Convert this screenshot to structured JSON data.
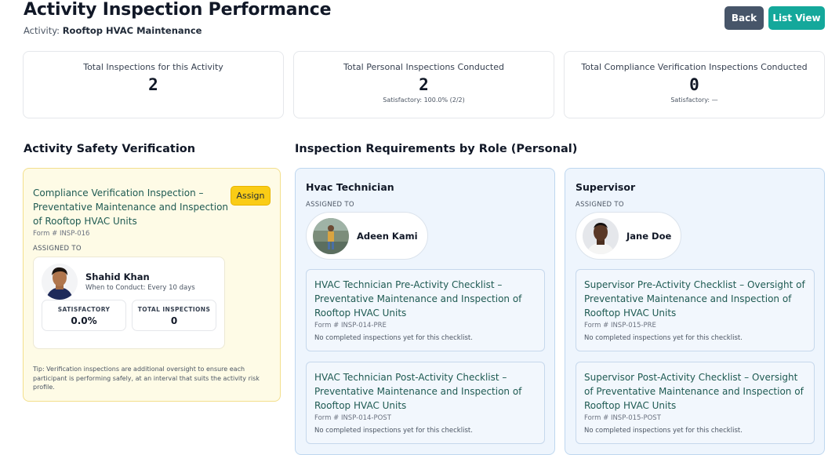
{
  "header": {
    "title": "Activity Inspection Performance",
    "activity_label": "Activity:",
    "activity_name": "Rooftop HVAC Maintenance",
    "back_label": "Back",
    "list_view_label": "List View"
  },
  "stats": [
    {
      "label": "Total Inspections for this Activity",
      "value": "2",
      "sub": ""
    },
    {
      "label": "Total Personal Inspections Conducted",
      "value": "2",
      "sub": "Satisfactory: 100.0% (2/2)"
    },
    {
      "label": "Total Compliance Verification Inspections Conducted",
      "value": "0",
      "sub": "Satisfactory: —"
    }
  ],
  "safety": {
    "heading": "Activity Safety Verification",
    "inspection_title": "Compliance Verification Inspection – Preventative Maintenance and Inspection of Rooftop HVAC Units",
    "form": "Form # INSP-016",
    "assign_label": "Assign",
    "assigned_to_label": "ASSIGNED TO",
    "person_name": "Shahid Khan",
    "when_to_conduct": "When to Conduct: Every 10 days",
    "satisfactory_label": "SATISFACTORY",
    "satisfactory_value": "0.0%",
    "total_label": "TOTAL INSPECTIONS",
    "total_value": "0",
    "tip": "Tip: Verification inspections are additional oversight to ensure each participant is performing safely, at an interval that suits the activity risk profile."
  },
  "roles_heading": "Inspection Requirements by Role (Personal)",
  "roles": [
    {
      "title": "Hvac Technician",
      "assigned_to_label": "ASSIGNED TO",
      "person": "Adeen Kami",
      "checklists": [
        {
          "title": "HVAC Technician Pre-Activity Checklist – Preventative Maintenance and Inspection of Rooftop HVAC Units",
          "form": "Form # INSP-014-PRE",
          "status": "No completed inspections yet for this checklist."
        },
        {
          "title": "HVAC Technician Post-Activity Checklist – Preventative Maintenance and Inspection of Rooftop HVAC Units",
          "form": "Form # INSP-014-POST",
          "status": "No completed inspections yet for this checklist."
        }
      ]
    },
    {
      "title": "Supervisor",
      "assigned_to_label": "ASSIGNED TO",
      "person": "Jane Doe",
      "checklists": [
        {
          "title": "Supervisor Pre-Activity Checklist – Oversight of Preventative Maintenance and Inspection of Rooftop HVAC Units",
          "form": "Form # INSP-015-PRE",
          "status": "No completed inspections yet for this checklist."
        },
        {
          "title": "Supervisor Post-Activity Checklist – Oversight of Preventative Maintenance and Inspection of Rooftop HVAC Units",
          "form": "Form # INSP-015-POST",
          "status": "No completed inspections yet for this checklist."
        }
      ]
    }
  ],
  "colors": {
    "back_button": "#475569",
    "list_view_button": "#14a89b",
    "assign_button": "#facc15",
    "link_text": "#1e5a52",
    "safety_panel_bg": "#fefbe6",
    "role_panel_bg": "#eef5fd"
  }
}
